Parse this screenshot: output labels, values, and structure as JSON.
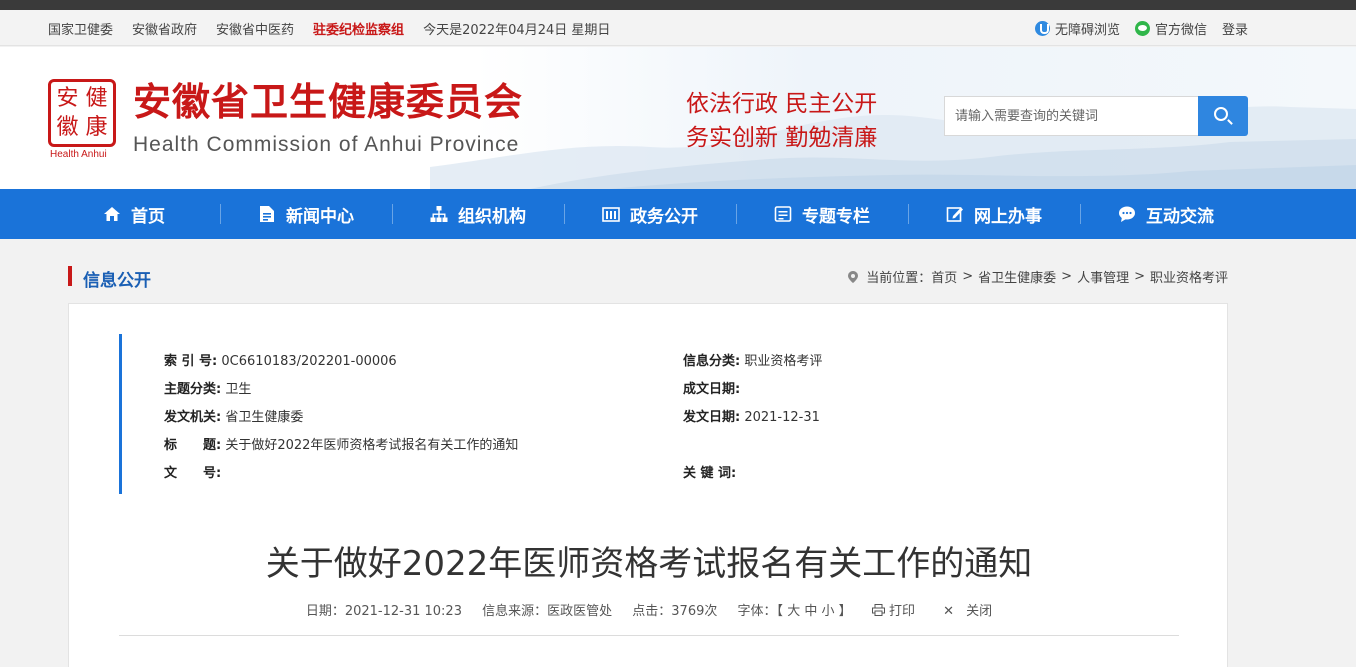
{
  "topbar": {
    "links": [
      "国家卫健委",
      "安徽省政府",
      "安徽省中医药"
    ],
    "highlight_link": "驻委纪检监察组",
    "date_text": "今天是2022年04月24日 星期日",
    "accessibility": "无障碍浏览",
    "wechat": "官方微信",
    "login": "登录"
  },
  "header": {
    "logo_chars": [
      "安",
      "健",
      "徽",
      "康"
    ],
    "logo_en": "Health Anhui",
    "title_cn": "安徽省卫生健康委员会",
    "title_en": "Health Commission of Anhui Province",
    "slogan_line1": "依法行政  民主公开",
    "slogan_line2": "务实创新  勤勉清廉",
    "search_placeholder": "请输入需要查询的关键词"
  },
  "nav": [
    {
      "label": "首页",
      "icon": "home-icon"
    },
    {
      "label": "新闻中心",
      "icon": "document-icon"
    },
    {
      "label": "组织机构",
      "icon": "org-chart-icon"
    },
    {
      "label": "政务公开",
      "icon": "building-icon"
    },
    {
      "label": "专题专栏",
      "icon": "topics-icon"
    },
    {
      "label": "网上办事",
      "icon": "edit-icon"
    },
    {
      "label": "互动交流",
      "icon": "chat-icon"
    }
  ],
  "section": {
    "title": "信息公开",
    "crumb_prefix": "当前位置：",
    "crumbs": [
      "首页",
      "省卫生健康委",
      "人事管理",
      "职业资格考评"
    ]
  },
  "meta": {
    "index_label": "索 引 号:",
    "index_value": "0C6610183/202201-00006",
    "category_label": "信息分类:",
    "category_value": "职业资格考评",
    "topic_label": "主题分类:",
    "topic_value": "卫生",
    "written_label": "成文日期:",
    "written_value": "",
    "issuer_label": "发文机关:",
    "issuer_value": "省卫生健康委",
    "issued_label": "发文日期:",
    "issued_value": "2021-12-31",
    "title_label": "标　　题:",
    "title_value": "关于做好2022年医师资格考试报名有关工作的通知",
    "docno_label": "文　　号:",
    "docno_value": "",
    "keywords_label": "关 键 词:",
    "keywords_value": ""
  },
  "article": {
    "title": "关于做好2022年医师资格考试报名有关工作的通知",
    "date": "日期：2021-12-31 10:23",
    "source": "信息来源：医政医管处",
    "views": "点击：3769次",
    "font_label": "字体：",
    "font_open": "【",
    "font_large": "大",
    "font_medium": "中",
    "font_small": "小",
    "font_close": "】",
    "print": "打印",
    "close": "关闭"
  },
  "colors": {
    "brand_red": "#c81818",
    "nav_blue": "#1a73d9",
    "search_blue": "#2f86e0"
  }
}
